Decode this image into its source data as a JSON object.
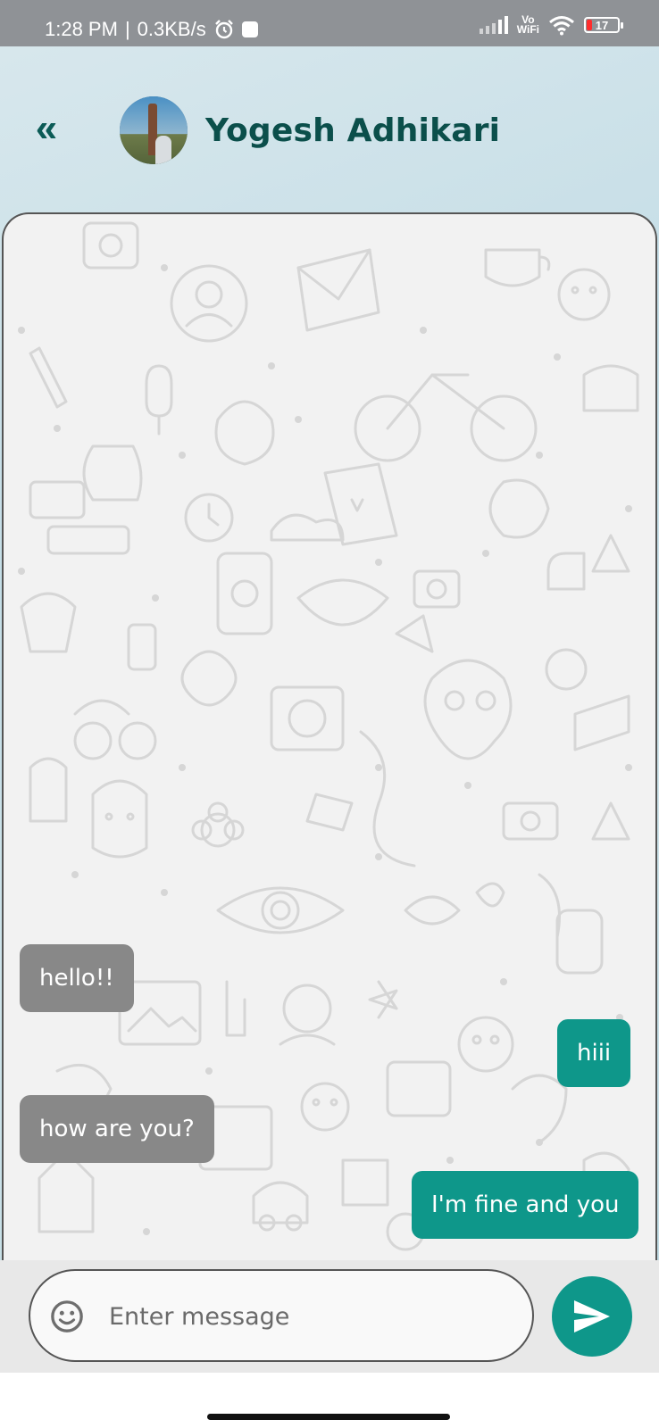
{
  "status_bar": {
    "time": "1:28 PM",
    "network_speed": "0.3KB/s",
    "vowifi_top": "Vo",
    "vowifi_bottom": "WiFi",
    "battery": "17",
    "icons": [
      "alarm-icon",
      "notification-icon",
      "signal-icon",
      "wifi-icon",
      "battery-icon"
    ]
  },
  "header": {
    "back_icon": "chevron-double-left-icon",
    "back_glyph": "«",
    "contact_name": "Yogesh Adhikari",
    "accent_color": "#0b4f4b"
  },
  "chat": {
    "messages": [
      {
        "direction": "incoming",
        "text": "hello!!"
      },
      {
        "direction": "outgoing",
        "text": "hiii"
      },
      {
        "direction": "incoming",
        "text": "how are you?"
      },
      {
        "direction": "outgoing",
        "text": "I'm fine and you"
      }
    ],
    "incoming_color": "#888888",
    "outgoing_color": "#0e978a"
  },
  "composer": {
    "placeholder": "Enter message",
    "value": "",
    "emoji_icon": "emoji-smile-icon",
    "send_icon": "send-icon"
  }
}
